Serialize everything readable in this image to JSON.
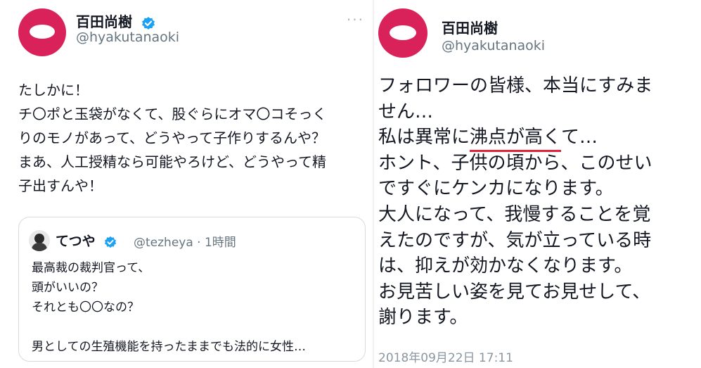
{
  "left": {
    "display_name": "百田尚樹",
    "handle": "@hyakutanaoki",
    "more_icon": "···",
    "text_lines": [
      "たしかに！",
      "チ〇ポと玉袋がなくて、股ぐらにオマ〇コそっく",
      "りのモノがあって、どうやって子作りするんや？",
      "まあ、人工授精なら可能やろけど、どうやって精",
      "子出すんや！"
    ],
    "quote": {
      "display_name": "てつや",
      "meta": "@tezheya · 1時間",
      "text_lines": [
        "最高裁の裁判官って、",
        "頭がいいの？",
        "それとも〇〇なの？",
        "",
        "男としての生殖機能を持ったままでも法的に女性…"
      ]
    }
  },
  "right": {
    "display_name": "百田尚樹",
    "handle": "@hyakutanaoki",
    "text_line_1": "フォロワーの皆様、本当にすみま",
    "text_line_2": "せん…",
    "text_line_3_pre": "私は異常に",
    "text_line_3_underlined": "沸点が高く",
    "text_line_3_post": "て…",
    "text_lines_rest": [
      "ホント、子供の頃から、このせい",
      "ですぐにケンカになります。",
      "大人になって、我慢することを覚",
      "えたのですが、気が立っている時",
      "は、抑えが効かなくなります。",
      "お見苦しい姿を見てお見せして、",
      "謝ります。"
    ],
    "timestamp": "2018年09月22日 17:11"
  },
  "colors": {
    "avatar_red": "#d9225a",
    "verified_blue": "#1da1f2",
    "underline_red": "#e0243a",
    "secondary_text": "#66757f"
  }
}
